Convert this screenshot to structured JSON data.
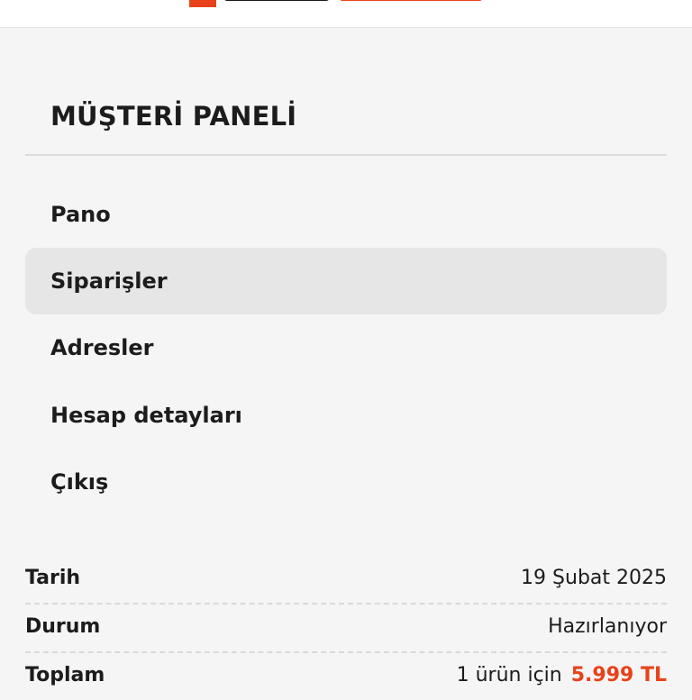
{
  "brand": {
    "accent_color": "#e8421a",
    "logo_icon": "brand-logo"
  },
  "panel": {
    "title": "MÜŞTERİ PANELİ"
  },
  "menu": {
    "items": [
      {
        "label": "Pano",
        "active": false
      },
      {
        "label": "Siparişler",
        "active": true
      },
      {
        "label": "Adresler",
        "active": false
      },
      {
        "label": "Hesap detayları",
        "active": false
      },
      {
        "label": "Çıkış",
        "active": false
      }
    ]
  },
  "order_summary": {
    "date_label": "Tarih",
    "date_value": "19 Şubat 2025",
    "status_label": "Durum",
    "status_value": "Hazırlanıyor",
    "total_label": "Toplam",
    "total_items_text": "1 ürün için",
    "total_price": "5.999 TL"
  }
}
